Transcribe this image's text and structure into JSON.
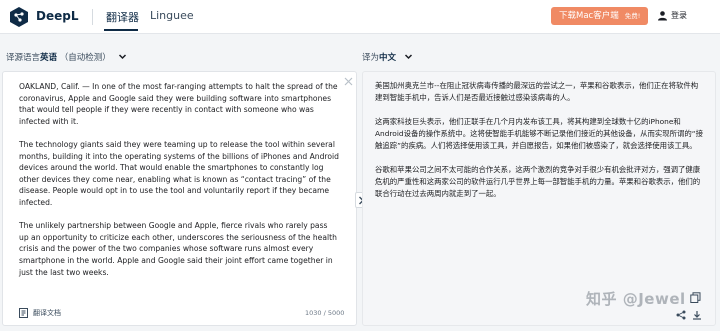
{
  "header": {
    "brand": "DeepL",
    "nav": [
      {
        "label": "翻译器"
      },
      {
        "label": "Linguee"
      }
    ],
    "download_button": "下载Mac客户端",
    "download_badge": "免费!",
    "login": "登录"
  },
  "langbar": {
    "source_prefix": "译源语言",
    "source_lang": "英语",
    "source_detect": "（自动检测）",
    "target_prefix": "译为",
    "target_lang": "中文"
  },
  "source": {
    "paragraphs": [
      "OAKLAND, Calif. — In one of the most far-ranging attempts to halt the spread of the coronavirus, Apple and Google said they were building software into smartphones that would tell people if they were recently in contact with someone who was infected with it.",
      "The technology giants said they were teaming up to release the tool within several months, building it into the operating systems of the billions of iPhones and Android devices around the world. That would enable the smartphones to constantly log other devices they come near, enabling what is known as “contact tracing” of the disease. People would opt in to use the tool and voluntarily report if they became infected.",
      "The unlikely partnership between Google and Apple, fierce rivals who rarely pass up an opportunity to criticize each other, underscores the seriousness of the health crisis and the power of the two companies whose software runs almost every smartphone in the world. Apple and Google said their joint effort came together in just the last two weeks."
    ],
    "document_label": "翻译文档",
    "counter": "1030 / 5000"
  },
  "target": {
    "paragraphs": [
      "美国加州奥克兰市--在阻止冠状病毒传播的最深远的尝试之一，苹果和谷歌表示，他们正在将软件构建到智能手机中，告诉人们是否最近接触过感染该病毒的人。",
      "这两家科技巨头表示，他们正联手在几个月内发布该工具，将其构建到全球数十亿的iPhone和Android设备的操作系统中。这将使智能手机能够不断记录他们接近的其他设备，从而实现所谓的“接触追踪”的疾病。人们将选择使用该工具，并自愿报告，如果他们被感染了，就会选择使用该工具。",
      "谷歌和苹果公司之间不太可能的合作关系，这两个激烈的竞争对手很少有机会批评对方，强调了健康危机的严重性和这两家公司的软件运行几乎世界上每一部智能手机的力量。苹果和谷歌表示，他们的联合行动在过去两周内就走到了一起。"
    ],
    "watermark": "知乎 @Jewel"
  },
  "colors": {
    "accent": "#f08a64",
    "brand_navy": "#0f2b46"
  }
}
